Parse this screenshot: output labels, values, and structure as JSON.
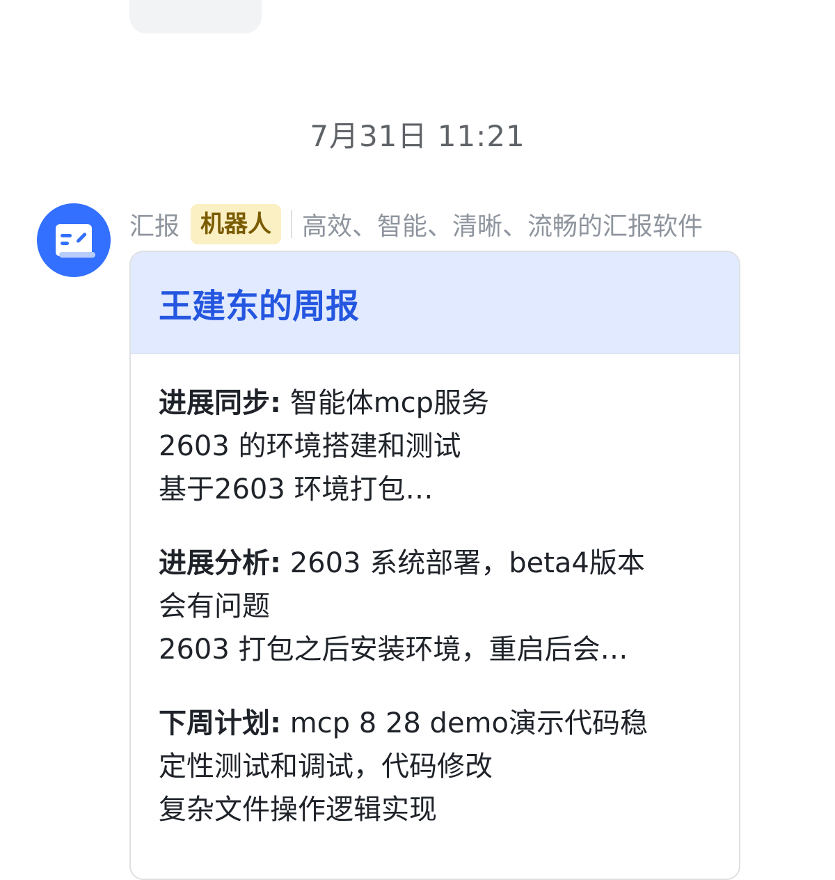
{
  "timestamp": "7月31日 11:21",
  "sender": {
    "name": "汇报",
    "badge": "机器人",
    "description": "高效、智能、清晰、流畅的汇报软件"
  },
  "card": {
    "title": "王建东的周报",
    "sections": [
      {
        "label": "进展同步:",
        "lines": [
          "智能体mcp服务",
          "2603 的环境搭建和测试",
          "基于2603 环境打包…"
        ]
      },
      {
        "label": "进展分析:",
        "lines": [
          "2603 系统部署，beta4版本",
          "会有问题",
          "2603 打包之后安装环境，重启后会…"
        ]
      },
      {
        "label": "下周计划:",
        "lines": [
          "mcp 8 28 demo演示代码稳",
          "定性测试和调试，代码修改",
          "复杂文件操作逻辑实现"
        ]
      }
    ]
  },
  "colors": {
    "accent": "#3370ff",
    "title": "#2456e0",
    "header_bg": "#e1eaff",
    "badge_bg": "#fbf0c4"
  },
  "icons": {
    "avatar": "report-app-icon"
  }
}
